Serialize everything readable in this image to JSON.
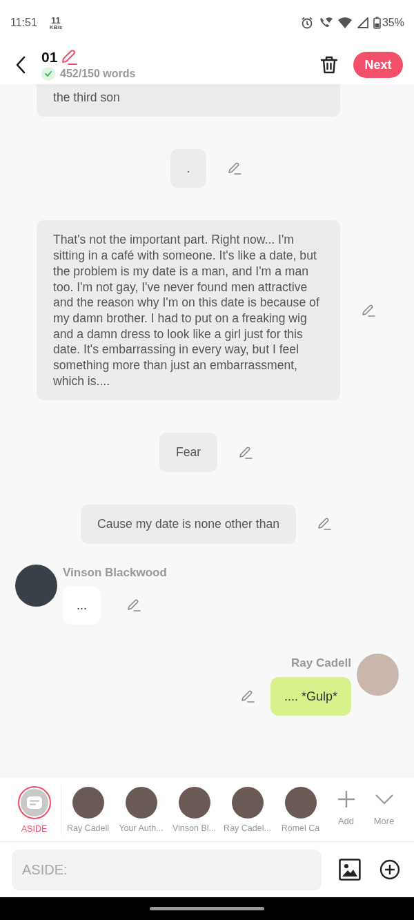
{
  "status_bar": {
    "time": "11:51",
    "net_speed": "11",
    "net_unit": "KB/s",
    "battery": "35%"
  },
  "header": {
    "title": "01",
    "word_count": "452/150 words",
    "word_goal_met": true,
    "next_button": "Next"
  },
  "messages": [
    {
      "kind": "narration",
      "text": "the third son"
    },
    {
      "kind": "narration",
      "text": "."
    },
    {
      "kind": "narration",
      "text": "That's not the important part. Right now... I'm sitting in a café with someone. It's like a date, but the problem is my date is a man, and I'm a man too. I'm not gay, I've never found men attractive and the reason why I'm on this date is because of my damn brother. I had to put on a freaking wig and a damn dress to look like a girl just for this date. It's embarrassing in every way, but I feel something more than just an embarrassment, which is...."
    },
    {
      "kind": "narration",
      "text": "Fear"
    },
    {
      "kind": "narration",
      "text": "Cause my date is none other than"
    },
    {
      "kind": "incoming",
      "name": "Vinson Blackwood",
      "text": "..."
    },
    {
      "kind": "outgoing",
      "name": "Ray Cadell",
      "text": ".... *Gulp*"
    }
  ],
  "characters": [
    {
      "kind": "aside",
      "label": "ASIDE",
      "selected": true
    },
    {
      "kind": "avatar",
      "label": "Ray Cadell",
      "selected": false
    },
    {
      "kind": "avatar",
      "label": "Your Auth...",
      "selected": false
    },
    {
      "kind": "avatar",
      "label": "Vinson Bl...",
      "selected": false
    },
    {
      "kind": "avatar",
      "label": "Ray Cadel...",
      "selected": false
    },
    {
      "kind": "avatar",
      "label": "Romel Ca",
      "selected": false
    }
  ],
  "actions": [
    {
      "kind": "add",
      "label": "Add"
    },
    {
      "kind": "more",
      "label": "More"
    }
  ],
  "composer": {
    "placeholder": "ASIDE:"
  }
}
